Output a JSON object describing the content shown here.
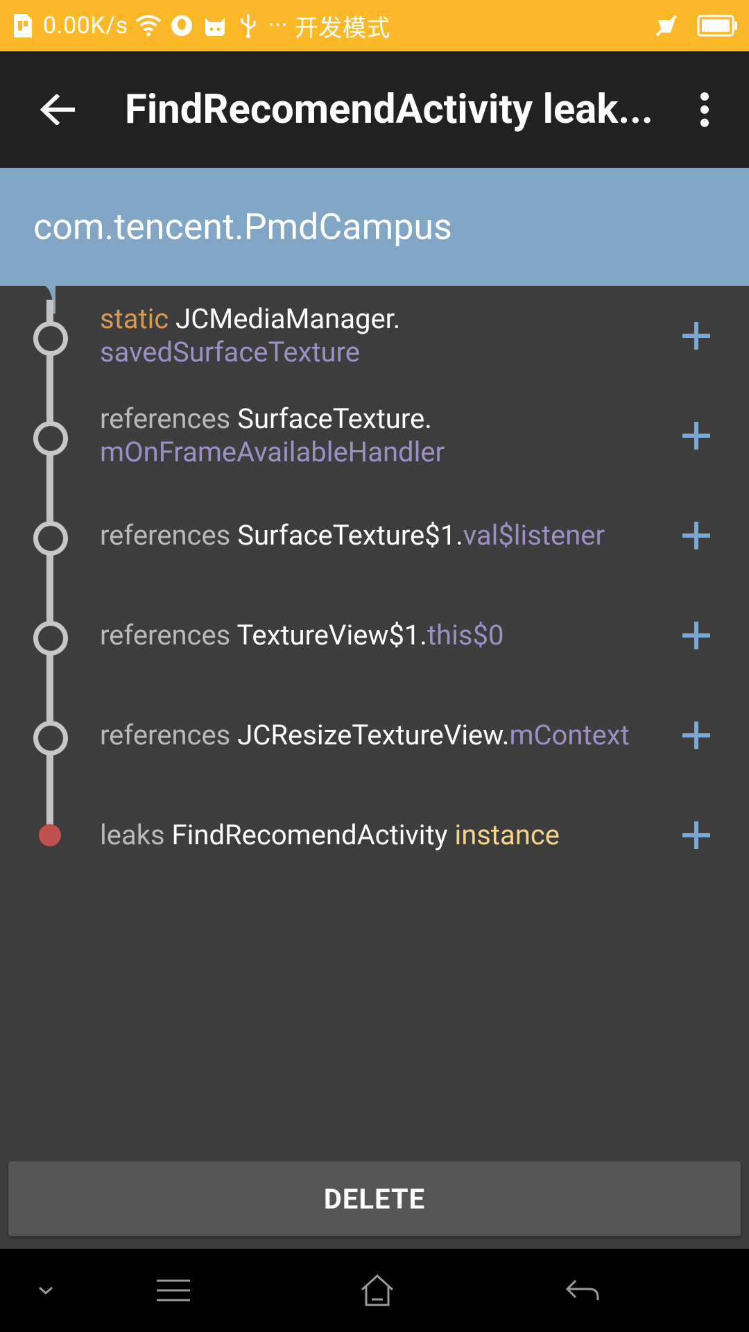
{
  "status_bar": {
    "speed": "0.00K/s",
    "mode_label": "开发模式",
    "more": "···"
  },
  "app_bar": {
    "title": "FindRecomendActivity leak..."
  },
  "header": {
    "package": "com.tencent.PmdCampus"
  },
  "trace": [
    {
      "prefix": "static",
      "class_name": "JCMediaManager.",
      "field": "savedSurfaceTexture"
    },
    {
      "prefix": "references",
      "class_name": "SurfaceTexture.",
      "field": "mOnFrameAvailableHandler"
    },
    {
      "prefix": "references",
      "class_name": "SurfaceTexture$1.",
      "field": "val$listener"
    },
    {
      "prefix": "references",
      "class_name": "TextureView$1.",
      "field": "this$0"
    },
    {
      "prefix": "references",
      "class_name": "JCResizeTextureView.",
      "field": "mContext"
    },
    {
      "prefix": "leaks",
      "class_name": "FindRecomendActivity",
      "field": "instance"
    }
  ],
  "delete_button": {
    "label": "DELETE"
  },
  "colors": {
    "status_bar": "#fbb829",
    "app_bar": "#212121",
    "header": "#82a7c6",
    "background": "#3d3d3d",
    "field": "#9c8fc3",
    "static_keyword": "#d89a52",
    "leak_instance": "#f4d38b",
    "leak_dot": "#c0504d",
    "expand_icon": "#7aa7d1"
  }
}
